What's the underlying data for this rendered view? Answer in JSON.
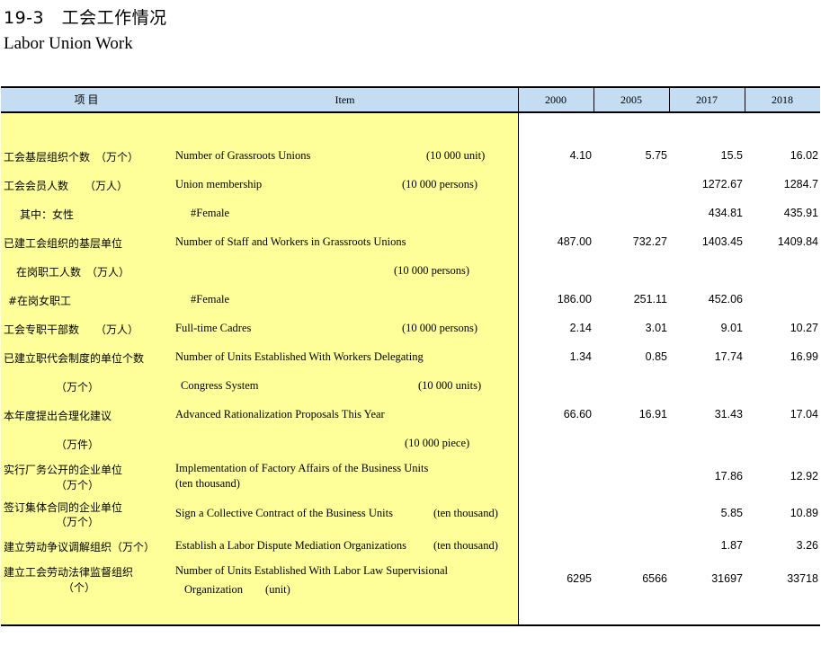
{
  "title": {
    "cn": "19-3　工会工作情况",
    "en": "Labor Union Work"
  },
  "header": {
    "cn": "项 目",
    "item": "Item",
    "years": [
      "2000",
      "2005",
      "2017",
      "2018"
    ]
  },
  "rows": [
    {
      "cn": "工会基层组织个数　（万个）",
      "en": "Number of Grassroots Unions",
      "unit": "(10 000 unit)",
      "values": [
        "4.10",
        "5.75",
        "15.5",
        "16.02"
      ]
    },
    {
      "cn": "工会会员人数　　（万人）",
      "en": "Union membership",
      "unit": "(10 000 persons)",
      "values": [
        "",
        "",
        "1272.67",
        "1284.7"
      ]
    },
    {
      "cn": "其中：女性",
      "en": "#Female",
      "unit": "",
      "values": [
        "",
        "",
        "434.81",
        "435.91"
      ]
    },
    {
      "cn": "已建工会组织的基层单位",
      "en": "Number of Staff and Workers in Grassroots Unions",
      "unit": "",
      "values": [
        "487.00",
        "732.27",
        "1403.45",
        "1409.84"
      ]
    },
    {
      "cn": "在岗职工人数　（万人）",
      "en": "",
      "unit": "(10 000 persons)",
      "values": [
        "",
        "",
        "",
        ""
      ]
    },
    {
      "cn": "#在岗女职工",
      "en": "#Female",
      "unit": "",
      "values": [
        "186.00",
        "251.11",
        "452.06",
        ""
      ]
    },
    {
      "cn": "工会专职干部数　　（万人）",
      "en": "Full-time Cadres",
      "unit": "(10 000 persons)",
      "values": [
        "2.14",
        "3.01",
        "9.01",
        "10.27"
      ]
    },
    {
      "cn": "已建立职代会制度的单位个数",
      "en": "Number of Units Established With Workers Delegating",
      "unit": "",
      "values": [
        "1.34",
        "0.85",
        "17.74",
        "16.99"
      ]
    },
    {
      "cn": "（万个）",
      "en": "Congress System",
      "unit": "(10 000 units)",
      "values": [
        "",
        "",
        "",
        ""
      ]
    },
    {
      "cn": "本年度提出合理化建议",
      "en": "Advanced Rationalization Proposals This Year",
      "unit": "",
      "values": [
        "66.60",
        "16.91",
        "31.43",
        "17.04"
      ]
    },
    {
      "cn": "（万件）",
      "en": "",
      "unit": "(10 000 piece)",
      "values": [
        "",
        "",
        "",
        ""
      ]
    },
    {
      "cn": "实行厂务公开的企业单位",
      "cn2": "（万个）",
      "en": "Implementation of Factory Affairs of the Business Units",
      "en2": "(ten thousand)",
      "unit": "",
      "values": [
        "",
        "",
        "17.86",
        "12.92"
      ]
    },
    {
      "cn": "签订集体合同的企业单位",
      "cn2": "（万个）",
      "en": "Sign a Collective Contract of the Business Units",
      "unit": "(ten thousand)",
      "values": [
        "",
        "",
        "5.85",
        "10.89"
      ]
    },
    {
      "cn": "建立劳动争议调解组织（万个）",
      "en": "Establish a Labor Dispute Mediation Organizations",
      "unit": "(ten thousand)",
      "values": [
        "",
        "",
        "1.87",
        "3.26"
      ]
    },
    {
      "cn": "建立工会劳动法律监督组织",
      "cn2": "（个）",
      "en": "Number of Units Established With Labor Law Supervisional",
      "en2": "Organization　　(unit)",
      "unit": "",
      "values": [
        "6295",
        "6566",
        "31697",
        "33718"
      ]
    }
  ]
}
